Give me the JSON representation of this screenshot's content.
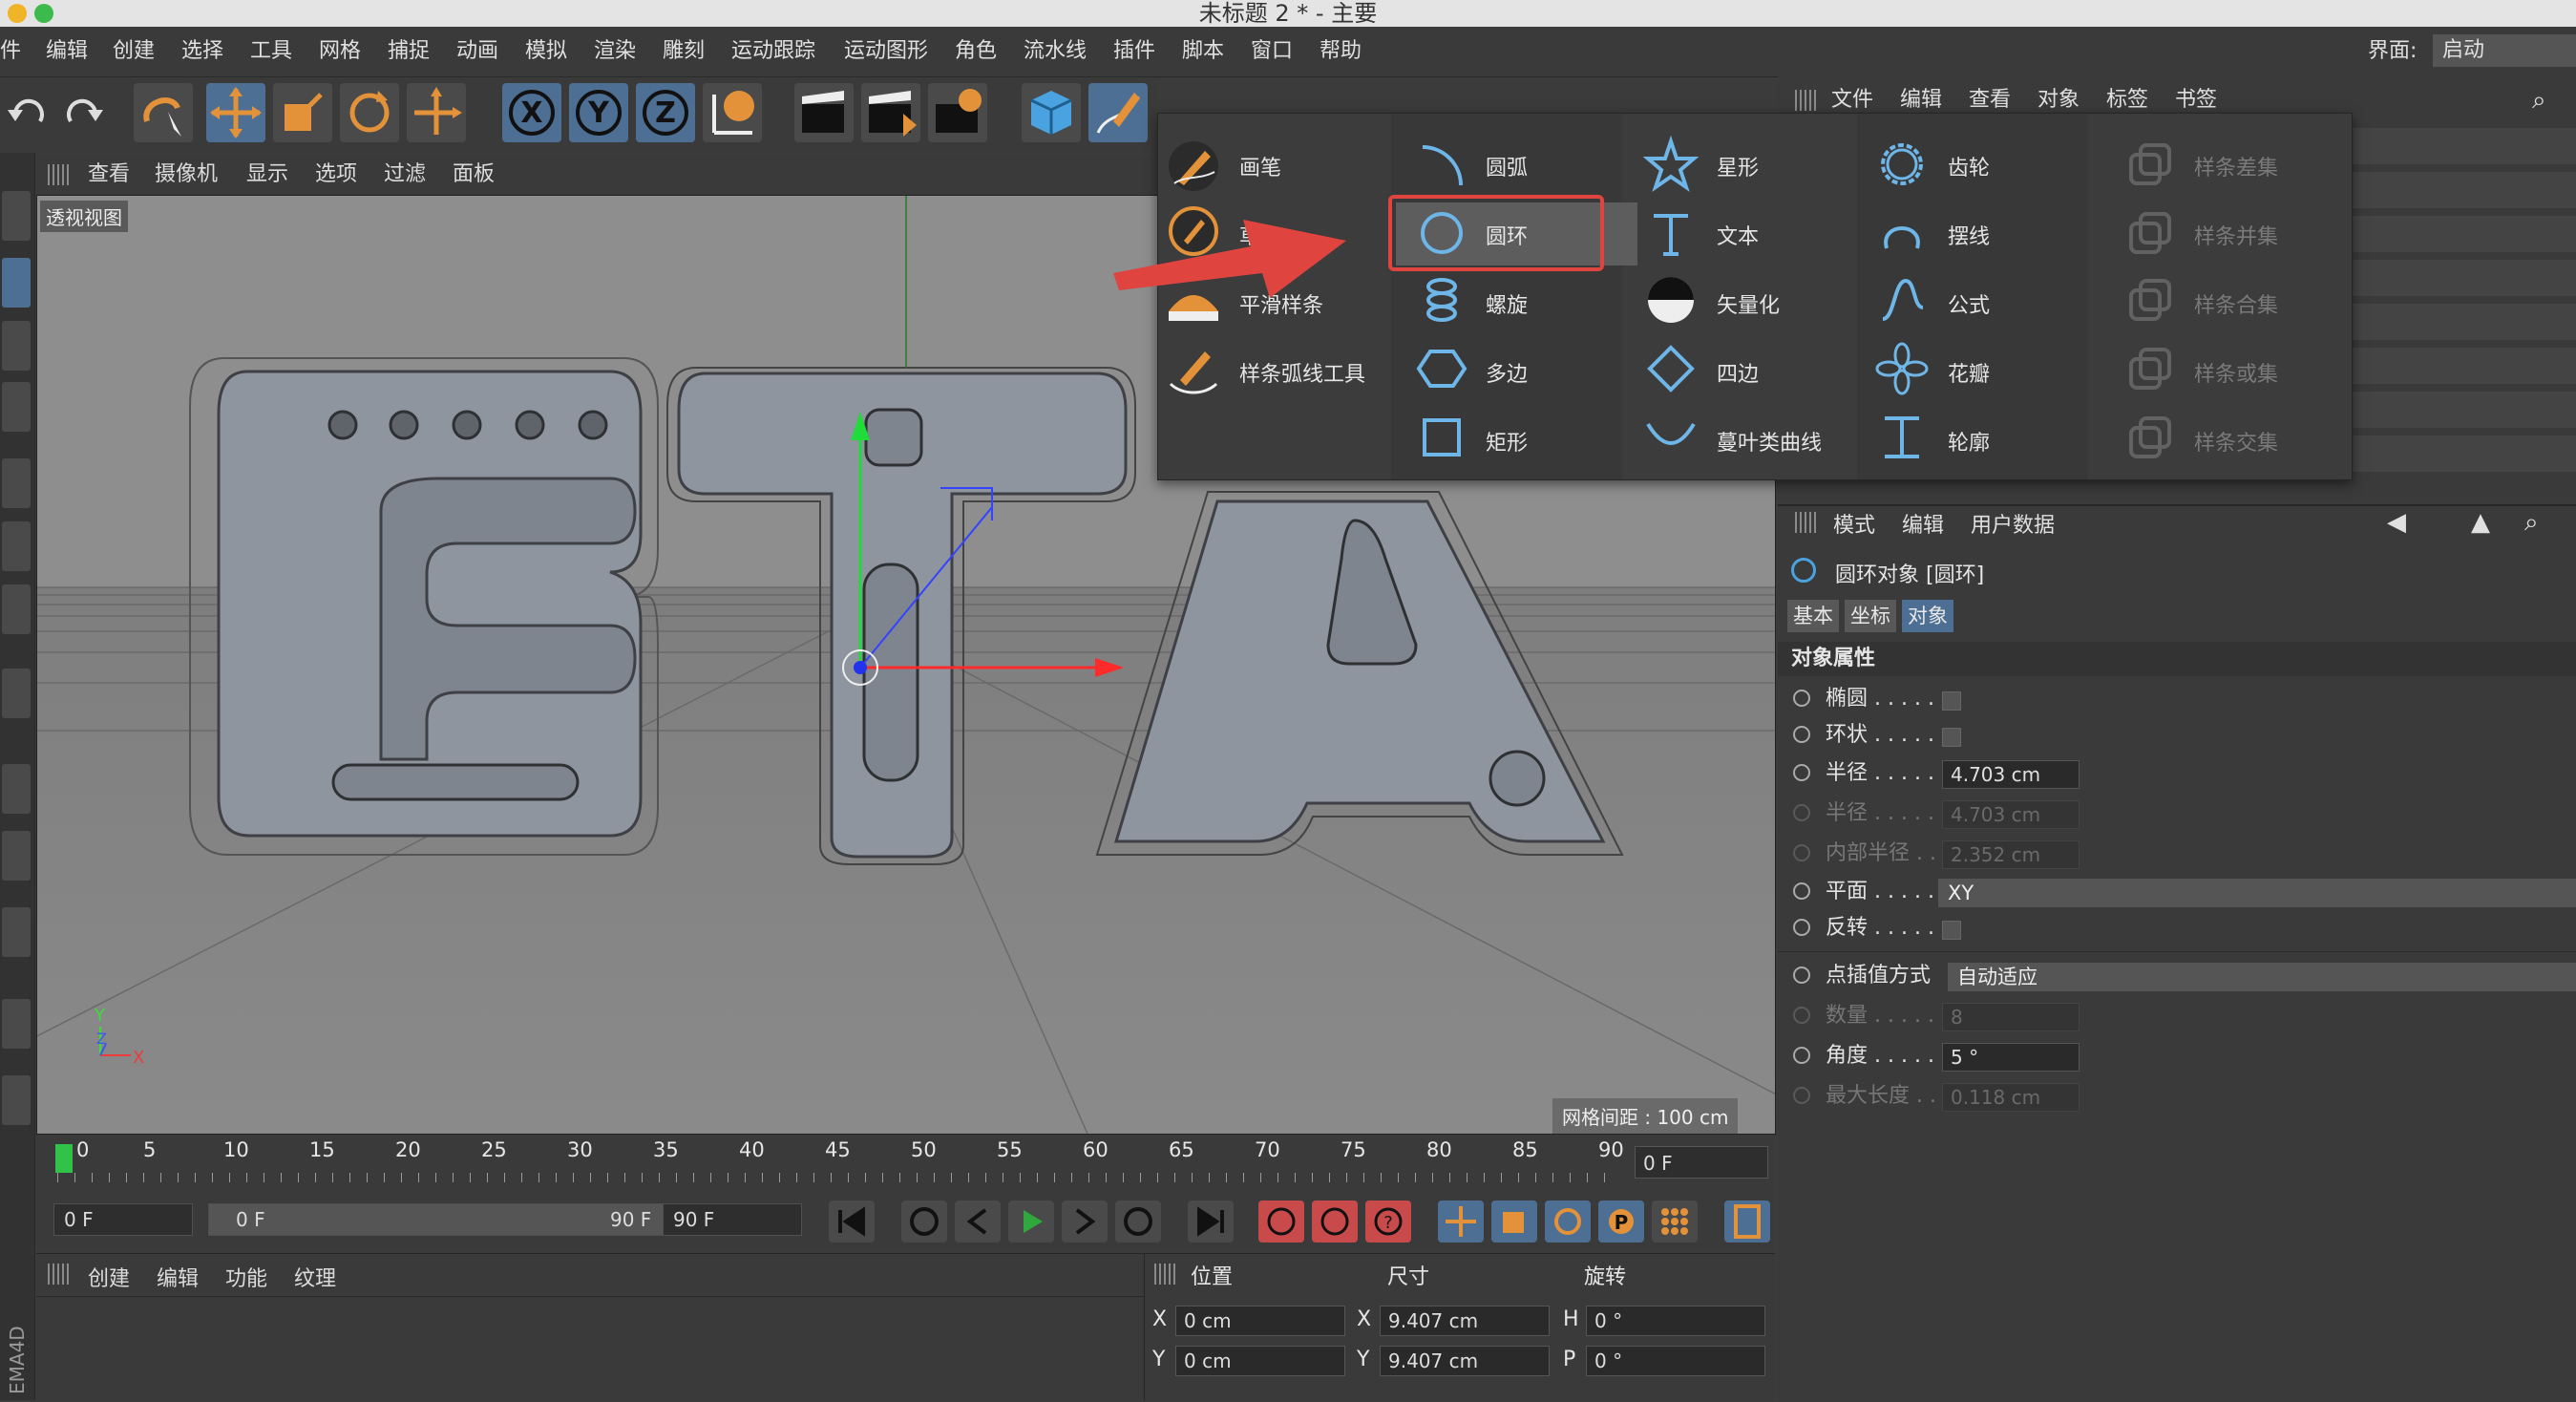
{
  "window": {
    "title": "未标题 2 * - 主要"
  },
  "menubar": {
    "items": [
      "件",
      "编辑",
      "创建",
      "选择",
      "工具",
      "网格",
      "捕捉",
      "动画",
      "模拟",
      "渲染",
      "雕刻",
      "运动跟踪",
      "运动图形",
      "角色",
      "流水线",
      "插件",
      "脚本",
      "窗口",
      "帮助"
    ],
    "layout_label": "界面:",
    "layout_value": "启动"
  },
  "viewport": {
    "menu": [
      "查看",
      "摄像机",
      "显示",
      "选项",
      "过滤",
      "面板"
    ],
    "label": "透视视图",
    "grid_label": "网格间距 : 100 cm",
    "scene_text": "ETA"
  },
  "timeline": {
    "ticks": [
      "0",
      "5",
      "10",
      "15",
      "20",
      "25",
      "30",
      "35",
      "40",
      "45",
      "50",
      "55",
      "60",
      "65",
      "70",
      "75",
      "80",
      "85",
      "90"
    ],
    "current_frame": "0 F",
    "start_field": "0 F",
    "range_start": "0 F",
    "range_end": "90 F",
    "end_field": "90 F"
  },
  "material_panel": {
    "menu": [
      "创建",
      "编辑",
      "功能",
      "纹理"
    ],
    "side_label": "EMA4D"
  },
  "coord_panel": {
    "headers": [
      "位置",
      "尺寸",
      "旋转"
    ],
    "rows": [
      {
        "a": "X",
        "av": "0 cm",
        "b": "X",
        "bv": "9.407 cm",
        "c": "H",
        "cv": "0 °"
      },
      {
        "a": "Y",
        "av": "0 cm",
        "b": "Y",
        "bv": "9.407 cm",
        "c": "P",
        "cv": "0 °"
      }
    ]
  },
  "object_manager": {
    "menu": [
      "文件",
      "编辑",
      "查看",
      "对象",
      "标签",
      "书签"
    ]
  },
  "attributes": {
    "menu": [
      "模式",
      "编辑",
      "用户数据"
    ],
    "object_title": "圆环对象 [圆环]",
    "tabs": [
      "基本",
      "坐标",
      "对象"
    ],
    "section": "对象属性",
    "props": [
      {
        "label": "椭圆 . . . . .",
        "type": "check",
        "dim": false
      },
      {
        "label": "环状 . . . . .",
        "type": "check",
        "dim": false
      },
      {
        "label": "半径 . . . . .",
        "type": "field",
        "value": "4.703 cm",
        "dim": false
      },
      {
        "label": "半径 . . . . .",
        "type": "field",
        "value": "4.703 cm",
        "dim": true
      },
      {
        "label": "内部半径 . .",
        "type": "field",
        "value": "2.352 cm",
        "dim": true
      },
      {
        "label": "平面 . . . . .",
        "type": "select",
        "value": "XY",
        "dim": false
      },
      {
        "label": "反转 . . . . .",
        "type": "check",
        "dim": false
      },
      {
        "label": "点插值方式",
        "type": "select",
        "value": "自动适应",
        "dim": false
      },
      {
        "label": "数量 . . . . .",
        "type": "field",
        "value": "8",
        "dim": true
      },
      {
        "label": "角度 . . . . .",
        "type": "field",
        "value": "5 °",
        "dim": false
      },
      {
        "label": "最大长度 . .",
        "type": "field",
        "value": "0.118 cm",
        "dim": true
      }
    ]
  },
  "spline_popup": {
    "col1": [
      "画笔",
      "草",
      "平滑样条",
      "样条弧线工具"
    ],
    "col2": [
      "圆弧",
      "圆环",
      "螺旋",
      "多边",
      "矩形"
    ],
    "col3": [
      "星形",
      "文本",
      "矢量化",
      "四边",
      "蔓叶类曲线"
    ],
    "col4": [
      "齿轮",
      "摆线",
      "公式",
      "花瓣",
      "轮廓"
    ],
    "col5": [
      "样条差集",
      "样条并集",
      "样条合集",
      "样条或集",
      "样条交集"
    ]
  },
  "colors": {
    "accent_blue": "#4d6f93",
    "highlight_red": "#e0443e",
    "icon_orange": "#e3923a",
    "viewport_gray": "#8c8c8c"
  }
}
